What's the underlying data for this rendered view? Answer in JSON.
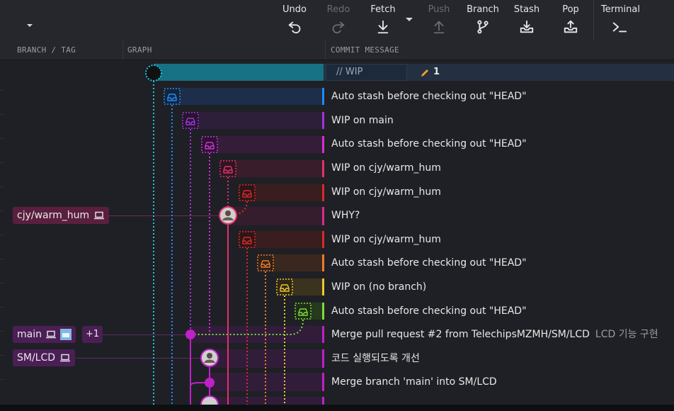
{
  "toolbar": {
    "undo": "Undo",
    "redo": "Redo",
    "fetch": "Fetch",
    "push": "Push",
    "branch": "Branch",
    "stash": "Stash",
    "pop": "Pop",
    "terminal": "Terminal"
  },
  "columns": {
    "branch_tag": "BRANCH / TAG",
    "graph": "GRAPH",
    "commit_message": "COMMIT MESSAGE"
  },
  "wip": {
    "label": "// WIP",
    "changes": "1"
  },
  "commits": [
    {
      "message": "Auto stash before checking out \"HEAD\"",
      "description": ""
    },
    {
      "message": "WIP on main",
      "description": ""
    },
    {
      "message": "Auto stash before checking out \"HEAD\"",
      "description": ""
    },
    {
      "message": "WIP on cjy/warm_hum",
      "description": ""
    },
    {
      "message": "WIP on cjy/warm_hum",
      "description": ""
    },
    {
      "message": "WHY?",
      "description": ""
    },
    {
      "message": "WIP on cjy/warm_hum",
      "description": ""
    },
    {
      "message": "Auto stash before checking out \"HEAD\"",
      "description": ""
    },
    {
      "message": "WIP on (no branch)",
      "description": ""
    },
    {
      "message": "Auto stash before checking out \"HEAD\"",
      "description": ""
    },
    {
      "message": "Merge pull request #2 from TelechipsMZMH/SM/LCD",
      "description": "LCD 기능 구현"
    },
    {
      "message": "코드 실행되도록 개선",
      "description": ""
    },
    {
      "message": "Merge branch 'main' into SM/LCD",
      "description": ""
    },
    {
      "message": "",
      "description": ""
    }
  ],
  "branches": {
    "cjy": {
      "name": "cjy/warm_hum"
    },
    "main": {
      "name": "main",
      "extra": "+1"
    },
    "smlcd": {
      "name": "SM/LCD"
    }
  },
  "colors": {
    "background": "#1f2025",
    "toolbar": "#25272d",
    "wip_lane": "#1ec4dc",
    "lane_blue": "#1c8cff",
    "lane_purple": "#a234d6",
    "lane_magenta": "#d42fd6",
    "lane_pink": "#e2316a",
    "lane_red": "#d82a2a",
    "lane_orange": "#ee7a2c",
    "lane_yellow": "#f0c62c",
    "lane_green": "#7bdc3c"
  }
}
